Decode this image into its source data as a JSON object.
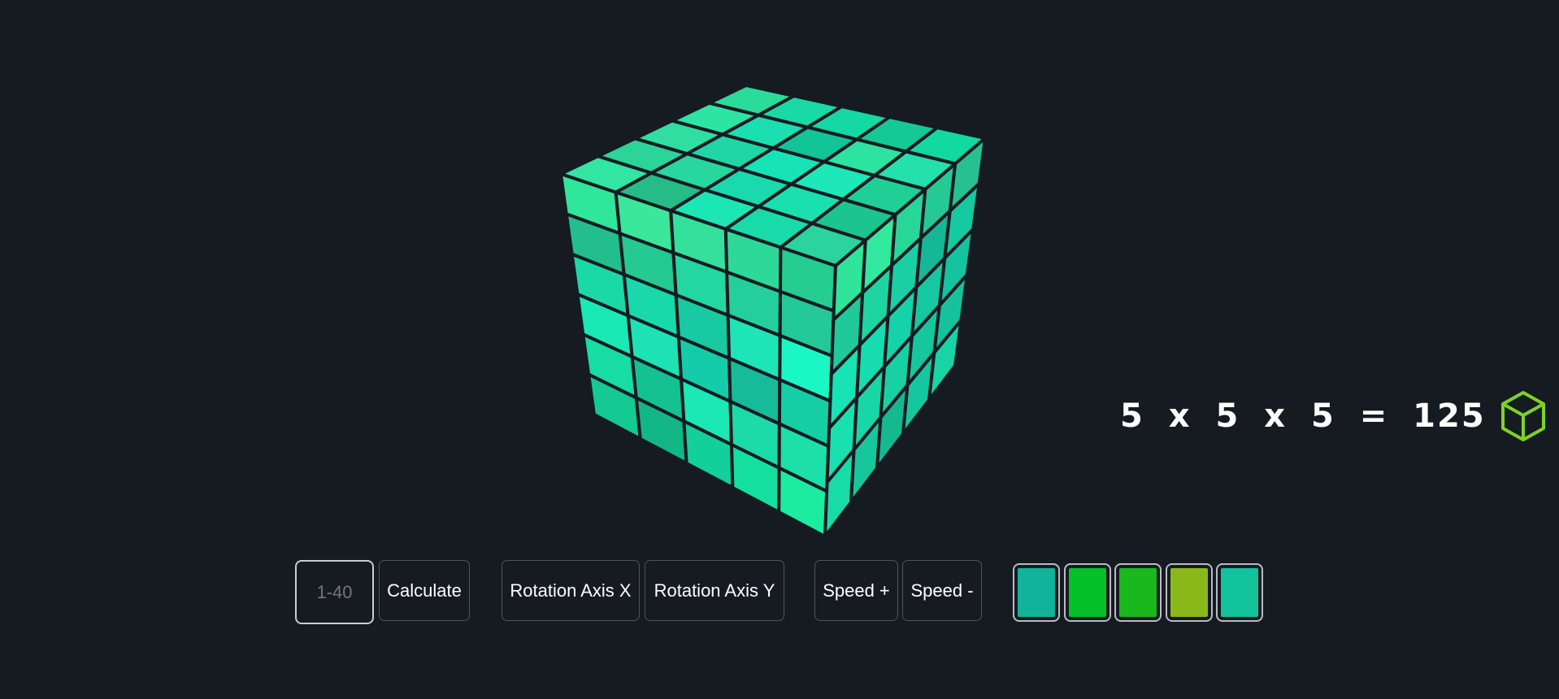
{
  "cube": {
    "size": 5,
    "top_colors": [
      [
        "#2bdb9a",
        "#19d9a6",
        "#14d9a4",
        "#14c995",
        "#12d9a0"
      ],
      [
        "#2ee4a5",
        "#1bdfb0",
        "#12c497",
        "#2ce3a0",
        "#24e0ac"
      ],
      [
        "#2fdea0",
        "#20d5a6",
        "#17e3b6",
        "#1ee7b8",
        "#1fcf95"
      ],
      [
        "#2cd49a",
        "#27d79e",
        "#1ad9ad",
        "#1ae0b0",
        "#1cc48e"
      ],
      [
        "#33e5a2",
        "#27bb88",
        "#1de6b5",
        "#19dbaa",
        "#2ad49c"
      ]
    ],
    "front_colors": [
      [
        "#2fe69b",
        "#3be79a",
        "#34e09c",
        "#2dd998",
        "#25cd90"
      ],
      [
        "#22be8c",
        "#25c992",
        "#24d7a0",
        "#23d09c",
        "#23c998"
      ],
      [
        "#1bd9a7",
        "#19d8aa",
        "#19c9a2",
        "#1ee5b8",
        "#1bf7c4"
      ],
      [
        "#1ae8b5",
        "#1de2b3",
        "#15ccaa",
        "#16bb99",
        "#15cea6"
      ],
      [
        "#17dca4",
        "#13c193",
        "#1be8b4",
        "#1cdba9",
        "#1ddfa9"
      ],
      [
        "#14c992",
        "#12b785",
        "#13cf9b",
        "#14df9f",
        "#1bec9f"
      ]
    ],
    "right_colors": [
      [
        "#2fe59a",
        "#33e99e",
        "#28d69a",
        "#25c993",
        "#27c08f"
      ],
      [
        "#1fc99a",
        "#1ed5a2",
        "#1bcfa5",
        "#16b797",
        "#15c9a0"
      ],
      [
        "#18e3b4",
        "#17dcb0",
        "#16d2aa",
        "#16c8a2",
        "#14c39f"
      ],
      [
        "#19e0ae",
        "#18d6a6",
        "#17d0a3",
        "#16c69d",
        "#15c29b"
      ],
      [
        "#17dca8",
        "#16c79b",
        "#15b891",
        "#15c79e",
        "#17d3a6"
      ]
    ],
    "edge_color": "#161b22"
  },
  "formula": {
    "text": "5 x 5 x 5 = 125",
    "icon": "cube-outline-icon",
    "icon_color": "#7ed321"
  },
  "controls": {
    "size_input_placeholder": "1-40",
    "calculate_label": "Calculate",
    "rotation_x_label": "Rotation Axis X",
    "rotation_y_label": "Rotation Axis Y",
    "speed_up_label": "Speed +",
    "speed_down_label": "Speed -"
  },
  "palette": [
    {
      "name": "teal",
      "color": "#12b39a"
    },
    {
      "name": "green",
      "color": "#04c12a"
    },
    {
      "name": "bright-green",
      "color": "#1ab81d"
    },
    {
      "name": "lime",
      "color": "#8ab81a"
    },
    {
      "name": "sea-green",
      "color": "#12c29b"
    }
  ]
}
